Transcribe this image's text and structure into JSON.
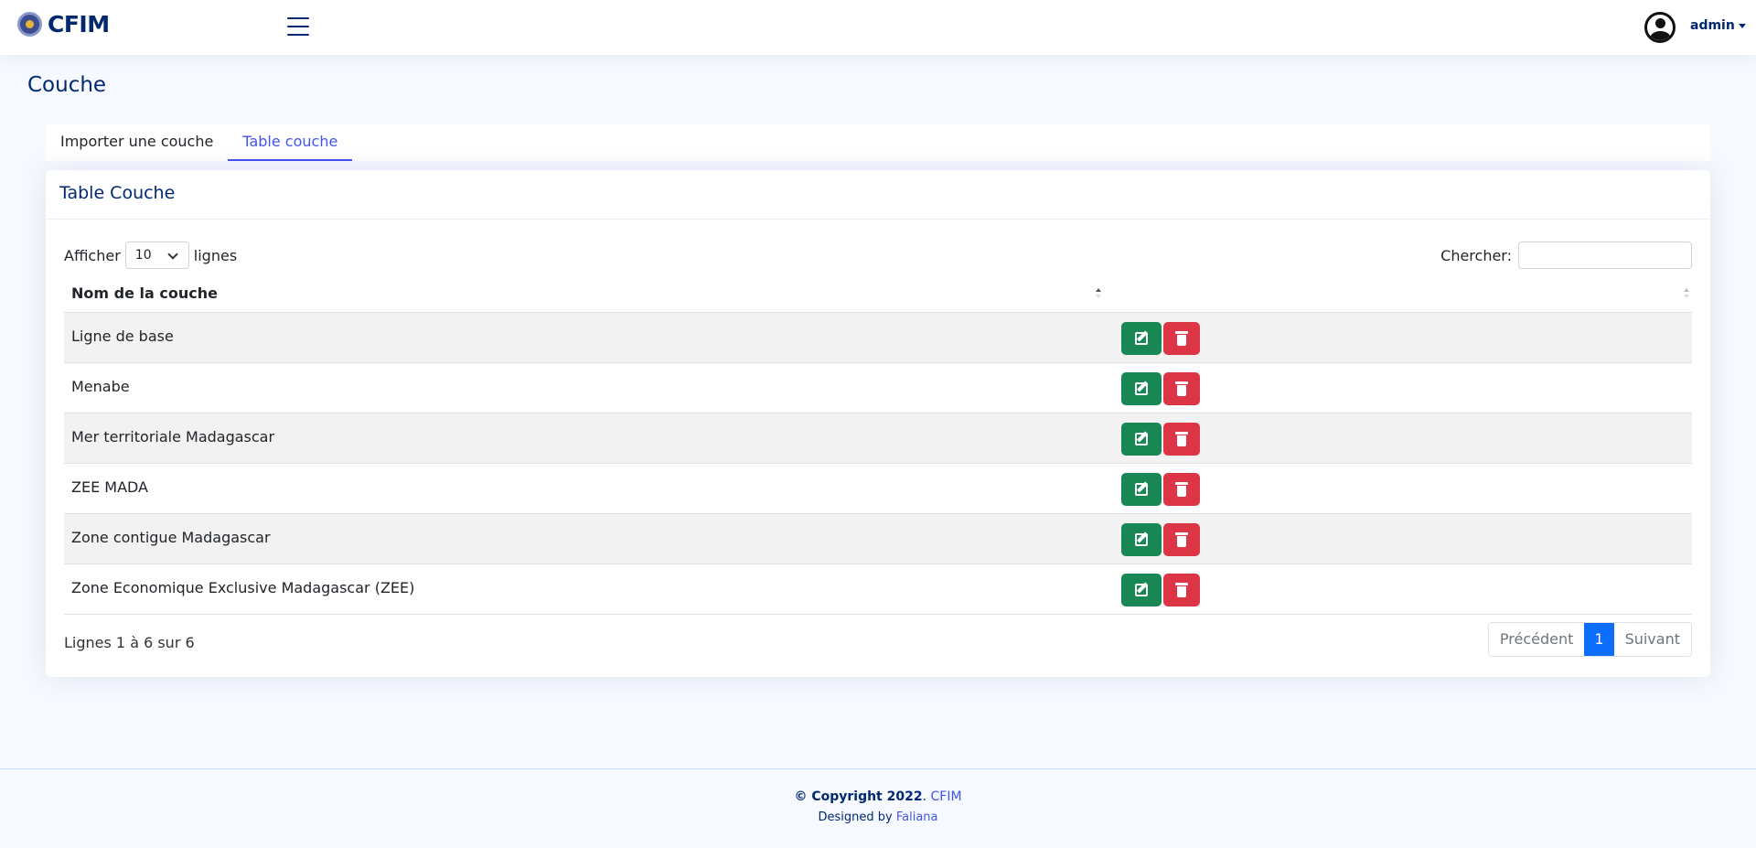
{
  "header": {
    "brand": "CFIM",
    "user": "admin"
  },
  "page": {
    "title": "Couche"
  },
  "tabs": [
    {
      "label": "Importer une couche"
    },
    {
      "label": "Table couche"
    }
  ],
  "card": {
    "title": "Table Couche",
    "length": {
      "prefix": "Afficher",
      "value": "10",
      "suffix": "lignes"
    },
    "search": {
      "label": "Chercher:",
      "value": ""
    },
    "columns": [
      "Nom de la couche",
      ""
    ],
    "rows": [
      {
        "name": "Ligne de base"
      },
      {
        "name": "Menabe"
      },
      {
        "name": "Mer territoriale Madagascar"
      },
      {
        "name": "ZEE MADA"
      },
      {
        "name": "Zone contigue Madagascar"
      },
      {
        "name": "Zone Economique Exclusive Madagascar (ZEE)"
      }
    ],
    "info": "Lignes 1 à 6 sur 6",
    "pagination": {
      "prev": "Précédent",
      "current": "1",
      "next": "Suivant"
    }
  },
  "footer": {
    "copyright_prefix": "© Copyright 2022",
    "brand": "CFIM",
    "designed_by": "Designed by",
    "designer": "Faliana"
  },
  "colors": {
    "primary": "#012970",
    "accent": "#4154f1",
    "edit": "#198754",
    "delete": "#dc3545",
    "page_active": "#0d6efd"
  }
}
